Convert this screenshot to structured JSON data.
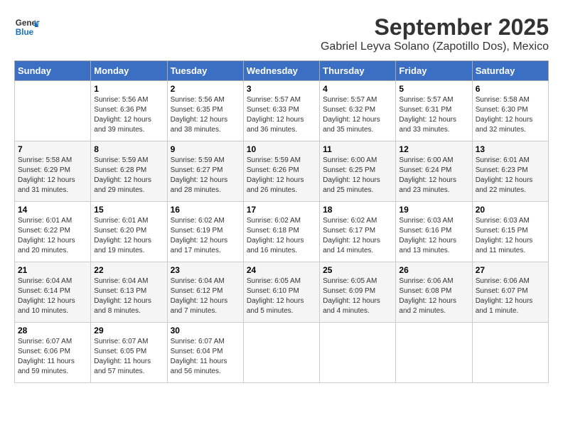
{
  "header": {
    "logo_line1": "General",
    "logo_line2": "Blue",
    "month": "September 2025",
    "location": "Gabriel Leyva Solano (Zapotillo Dos), Mexico"
  },
  "days_of_week": [
    "Sunday",
    "Monday",
    "Tuesday",
    "Wednesday",
    "Thursday",
    "Friday",
    "Saturday"
  ],
  "weeks": [
    [
      {
        "day": "",
        "info": ""
      },
      {
        "day": "1",
        "info": "Sunrise: 5:56 AM\nSunset: 6:36 PM\nDaylight: 12 hours\nand 39 minutes."
      },
      {
        "day": "2",
        "info": "Sunrise: 5:56 AM\nSunset: 6:35 PM\nDaylight: 12 hours\nand 38 minutes."
      },
      {
        "day": "3",
        "info": "Sunrise: 5:57 AM\nSunset: 6:33 PM\nDaylight: 12 hours\nand 36 minutes."
      },
      {
        "day": "4",
        "info": "Sunrise: 5:57 AM\nSunset: 6:32 PM\nDaylight: 12 hours\nand 35 minutes."
      },
      {
        "day": "5",
        "info": "Sunrise: 5:57 AM\nSunset: 6:31 PM\nDaylight: 12 hours\nand 33 minutes."
      },
      {
        "day": "6",
        "info": "Sunrise: 5:58 AM\nSunset: 6:30 PM\nDaylight: 12 hours\nand 32 minutes."
      }
    ],
    [
      {
        "day": "7",
        "info": "Sunrise: 5:58 AM\nSunset: 6:29 PM\nDaylight: 12 hours\nand 31 minutes."
      },
      {
        "day": "8",
        "info": "Sunrise: 5:59 AM\nSunset: 6:28 PM\nDaylight: 12 hours\nand 29 minutes."
      },
      {
        "day": "9",
        "info": "Sunrise: 5:59 AM\nSunset: 6:27 PM\nDaylight: 12 hours\nand 28 minutes."
      },
      {
        "day": "10",
        "info": "Sunrise: 5:59 AM\nSunset: 6:26 PM\nDaylight: 12 hours\nand 26 minutes."
      },
      {
        "day": "11",
        "info": "Sunrise: 6:00 AM\nSunset: 6:25 PM\nDaylight: 12 hours\nand 25 minutes."
      },
      {
        "day": "12",
        "info": "Sunrise: 6:00 AM\nSunset: 6:24 PM\nDaylight: 12 hours\nand 23 minutes."
      },
      {
        "day": "13",
        "info": "Sunrise: 6:01 AM\nSunset: 6:23 PM\nDaylight: 12 hours\nand 22 minutes."
      }
    ],
    [
      {
        "day": "14",
        "info": "Sunrise: 6:01 AM\nSunset: 6:22 PM\nDaylight: 12 hours\nand 20 minutes."
      },
      {
        "day": "15",
        "info": "Sunrise: 6:01 AM\nSunset: 6:20 PM\nDaylight: 12 hours\nand 19 minutes."
      },
      {
        "day": "16",
        "info": "Sunrise: 6:02 AM\nSunset: 6:19 PM\nDaylight: 12 hours\nand 17 minutes."
      },
      {
        "day": "17",
        "info": "Sunrise: 6:02 AM\nSunset: 6:18 PM\nDaylight: 12 hours\nand 16 minutes."
      },
      {
        "day": "18",
        "info": "Sunrise: 6:02 AM\nSunset: 6:17 PM\nDaylight: 12 hours\nand 14 minutes."
      },
      {
        "day": "19",
        "info": "Sunrise: 6:03 AM\nSunset: 6:16 PM\nDaylight: 12 hours\nand 13 minutes."
      },
      {
        "day": "20",
        "info": "Sunrise: 6:03 AM\nSunset: 6:15 PM\nDaylight: 12 hours\nand 11 minutes."
      }
    ],
    [
      {
        "day": "21",
        "info": "Sunrise: 6:04 AM\nSunset: 6:14 PM\nDaylight: 12 hours\nand 10 minutes."
      },
      {
        "day": "22",
        "info": "Sunrise: 6:04 AM\nSunset: 6:13 PM\nDaylight: 12 hours\nand 8 minutes."
      },
      {
        "day": "23",
        "info": "Sunrise: 6:04 AM\nSunset: 6:12 PM\nDaylight: 12 hours\nand 7 minutes."
      },
      {
        "day": "24",
        "info": "Sunrise: 6:05 AM\nSunset: 6:10 PM\nDaylight: 12 hours\nand 5 minutes."
      },
      {
        "day": "25",
        "info": "Sunrise: 6:05 AM\nSunset: 6:09 PM\nDaylight: 12 hours\nand 4 minutes."
      },
      {
        "day": "26",
        "info": "Sunrise: 6:06 AM\nSunset: 6:08 PM\nDaylight: 12 hours\nand 2 minutes."
      },
      {
        "day": "27",
        "info": "Sunrise: 6:06 AM\nSunset: 6:07 PM\nDaylight: 12 hours\nand 1 minute."
      }
    ],
    [
      {
        "day": "28",
        "info": "Sunrise: 6:07 AM\nSunset: 6:06 PM\nDaylight: 11 hours\nand 59 minutes."
      },
      {
        "day": "29",
        "info": "Sunrise: 6:07 AM\nSunset: 6:05 PM\nDaylight: 11 hours\nand 57 minutes."
      },
      {
        "day": "30",
        "info": "Sunrise: 6:07 AM\nSunset: 6:04 PM\nDaylight: 11 hours\nand 56 minutes."
      },
      {
        "day": "",
        "info": ""
      },
      {
        "day": "",
        "info": ""
      },
      {
        "day": "",
        "info": ""
      },
      {
        "day": "",
        "info": ""
      }
    ]
  ]
}
